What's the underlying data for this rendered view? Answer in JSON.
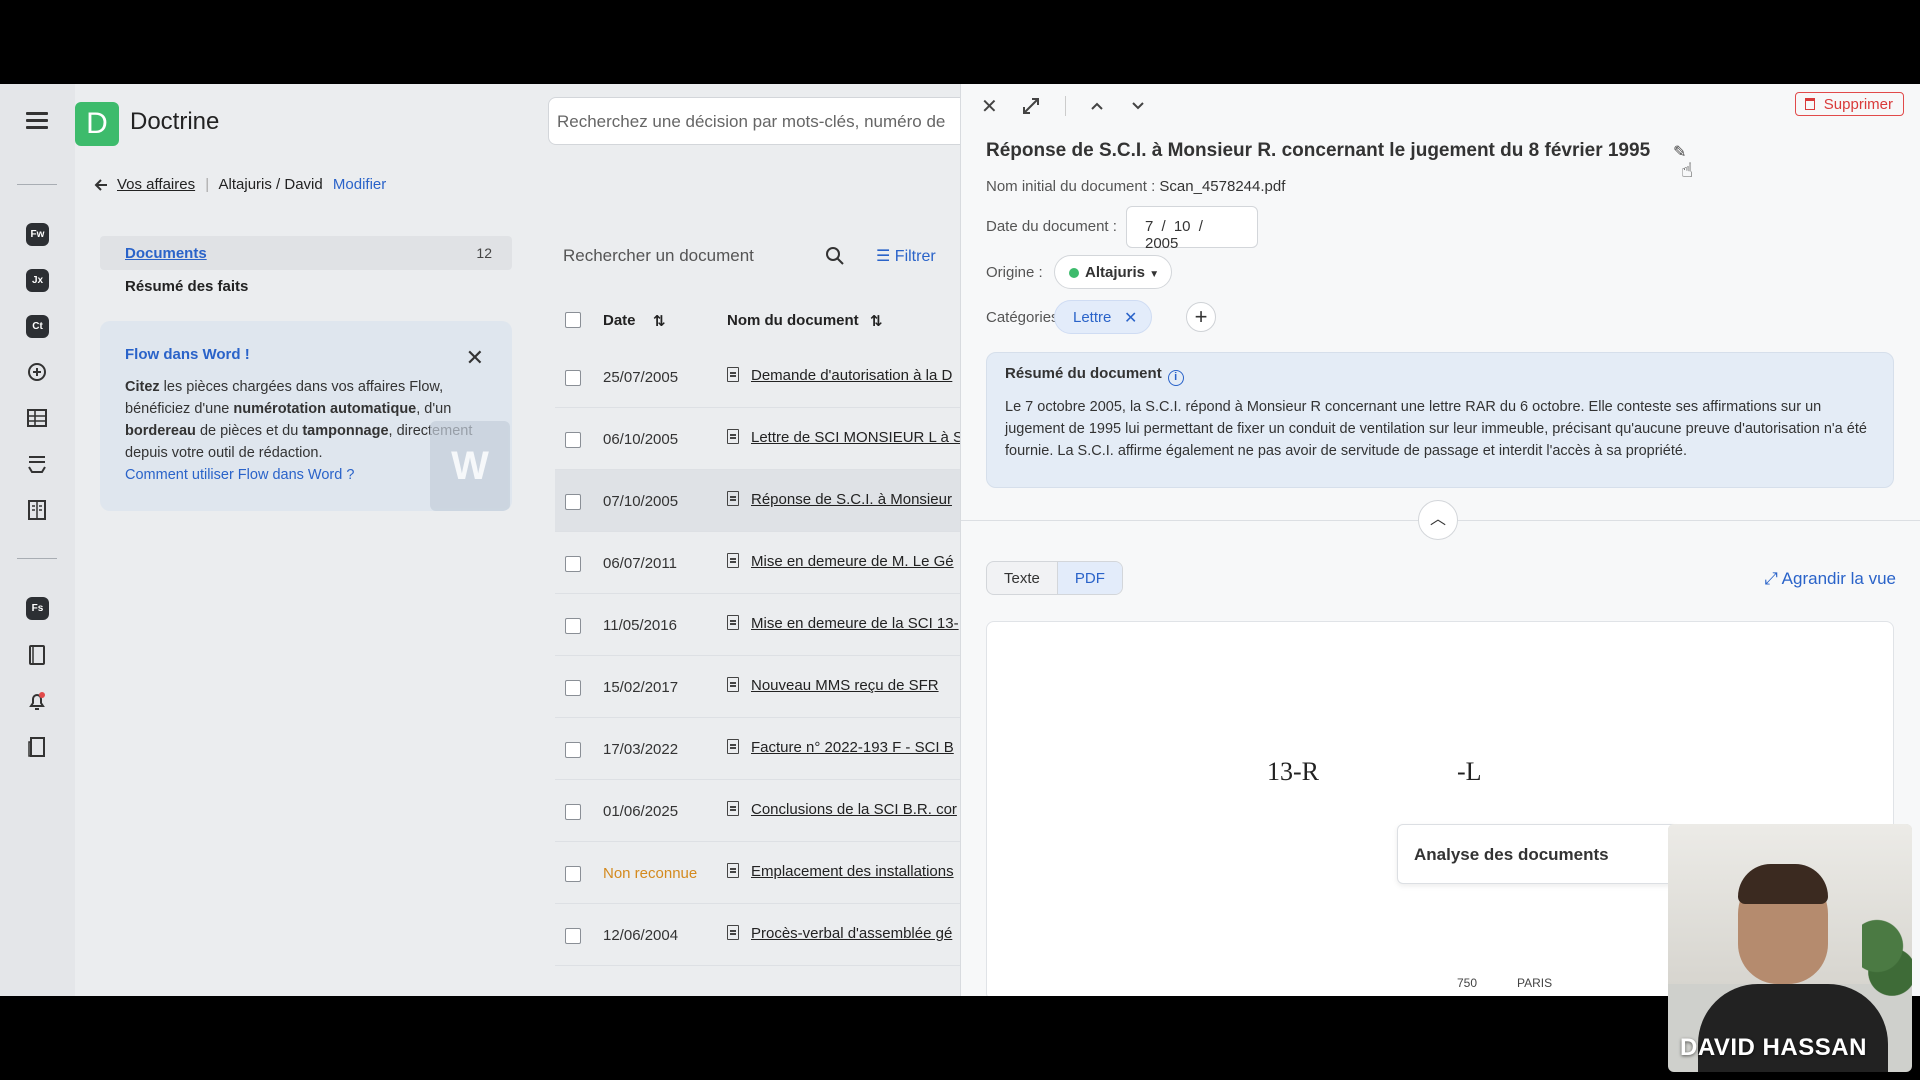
{
  "header": {
    "brand_letter": "D",
    "brand": "Doctrine",
    "search_placeholder": "Recherchez une décision par mots-clés, numéro de"
  },
  "breadcrumb": {
    "back": "Vos affaires",
    "path": "Altajuris / David",
    "edit": "Modifier"
  },
  "rail": {
    "chips": [
      "Fw",
      "Jx",
      "Ct",
      "Fs"
    ]
  },
  "leftnav": {
    "documents_label": "Documents",
    "documents_count": "12",
    "resume_label": "Résumé des faits"
  },
  "flow_card": {
    "title": "Flow dans Word !",
    "t1": "Citez",
    "t2": " les pièces chargées dans vos affaires Flow, bénéficiez d'une ",
    "t3": "numérotation automatique",
    "t4": ", d'un ",
    "t5": "bordereau",
    "t6": " de pièces et du ",
    "t7": "tamponnage",
    "t8": ", directement depuis votre outil de rédaction.",
    "link": "Comment utiliser Flow dans Word ?"
  },
  "doclist": {
    "search_placeholder": "Rechercher un document",
    "filter": "Filtrer",
    "col_date": "Date",
    "col_name": "Nom du document",
    "rows": [
      {
        "date": "25/07/2005",
        "name": "Demande d'autorisation à la D"
      },
      {
        "date": "06/10/2005",
        "name": "Lettre de SCI MONSIEUR L à S"
      },
      {
        "date": "07/10/2005",
        "name": "Réponse de S.C.I. à Monsieur"
      },
      {
        "date": "06/07/2011",
        "name": "Mise en demeure de M. Le Gé"
      },
      {
        "date": "11/05/2016",
        "name": "Mise en demeure de la SCI 13-"
      },
      {
        "date": "15/02/2017",
        "name": "Nouveau MMS reçu de SFR"
      },
      {
        "date": "17/03/2022",
        "name": "Facture n° 2022-193 F - SCI B"
      },
      {
        "date": "01/06/2025",
        "name": "Conclusions de la SCI B.R. cor"
      },
      {
        "date": "Non reconnue",
        "name": "Emplacement des installations"
      },
      {
        "date": "12/06/2004",
        "name": "Procès-verbal d'assemblée gé"
      }
    ]
  },
  "panel": {
    "delete": "Supprimer",
    "title": "Réponse de S.C.I. à Monsieur R. concernant le jugement du 8 février 1995",
    "initial_name_label": "Nom initial du document :",
    "initial_name": "Scan_4578244.pdf",
    "date_label": "Date du document :",
    "date_value": "7 / 10 / 2005",
    "origin_label": "Origine :",
    "origin_value": "Altajuris",
    "categories_label": "Catégories :",
    "category": "Lettre",
    "summary_title": "Résumé du document",
    "summary_text": "Le 7 octobre 2005, la S.C.I. répond à Monsieur R concernant une lettre RAR du 6 octobre. Elle conteste ses affirmations sur un jugement de 1995 lui permettant de fixer un conduit de ventilation sur leur immeuble, précisant qu'aucune preuve d'autorisation n'a été fournie. La S.C.I. affirme également ne pas avoir de servitude de passage et interdit l'accès à sa propriété.",
    "tab_text": "Texte",
    "tab_pdf": "PDF",
    "enlarge": "Agrandir la vue",
    "scan_a": "13-R",
    "scan_b": "-L",
    "scan_c": "750",
    "scan_d": "PARIS",
    "analyse": "Analyse des documents"
  },
  "webcam": {
    "name": "DAVID HASSAN"
  }
}
